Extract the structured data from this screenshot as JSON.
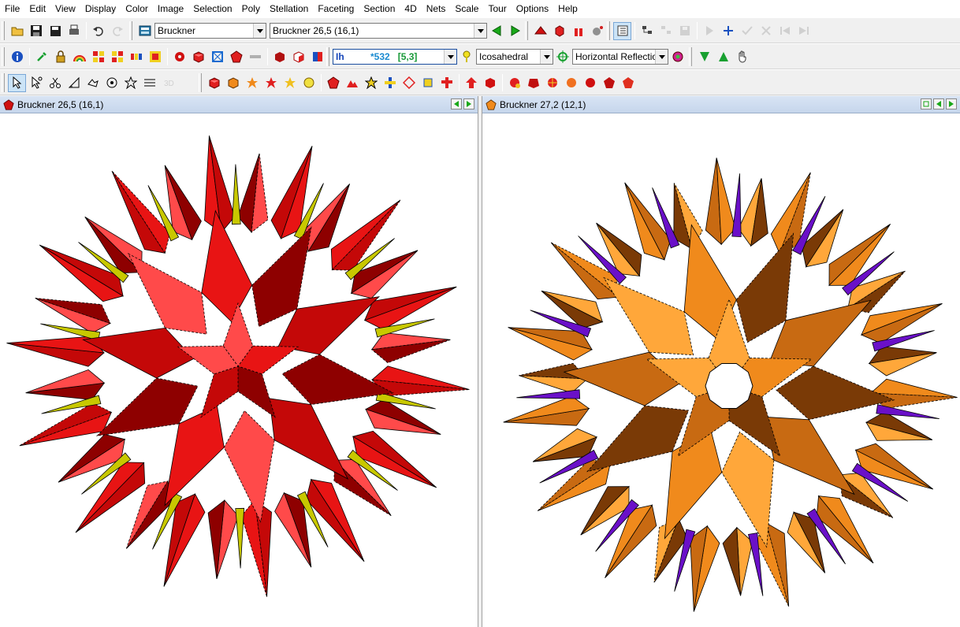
{
  "menu": [
    "File",
    "Edit",
    "View",
    "Display",
    "Color",
    "Image",
    "Selection",
    "Poly",
    "Stellation",
    "Faceting",
    "Section",
    "4D",
    "Nets",
    "Scale",
    "Tour",
    "Options",
    "Help"
  ],
  "toolbar1": {
    "category_value": "Bruckner",
    "model_value": "Bruckner 26,5 (16,1)"
  },
  "toolbar2": {
    "symmetry_label": "Ih",
    "symmetry_orbifold": "*532",
    "symmetry_coxeter": "[5,3]",
    "group_value": "Icosahedral",
    "reflection_value": "Horizontal Reflection"
  },
  "left_pane": {
    "title": "Bruckner 26,5 (16,1)",
    "colors": {
      "face": "#e81414",
      "dark": "#8e0000",
      "mid": "#c40808",
      "light": "#ff4a4a",
      "accent": "#c8c800"
    }
  },
  "right_pane": {
    "title": "Bruckner 27,2 (12,1)",
    "colors": {
      "face": "#f08a1c",
      "dark": "#7a3a06",
      "mid": "#c86a12",
      "light": "#ffa73a",
      "accent": "#6a10c8"
    }
  },
  "icons": {
    "toolbar1": [
      "open-icon",
      "save-icon",
      "save-all-icon",
      "print-icon",
      "undo-icon",
      "redo-icon",
      "model-category-icon",
      "prev-model-icon",
      "next-model-icon",
      "poly-red-icon",
      "poly-cube-icon",
      "poly-gift-icon",
      "poly-gray-icon",
      "list-view-icon",
      "tree-a-icon",
      "tree-b-icon",
      "save-gray-icon",
      "play-icon",
      "add-icon",
      "check-icon",
      "cross-icon",
      "first-icon",
      "last-icon"
    ],
    "toolbar2": [
      "info-icon",
      "wrench-icon",
      "lock-icon",
      "rainbow-icon",
      "grid-a-icon",
      "grid-b-icon",
      "grid-c-icon",
      "grid-d-icon",
      "gear-red-icon",
      "cube-red-icon",
      "frame-icon",
      "pentagon-red-icon",
      "bar-gray-icon",
      "box-icon",
      "box-white-icon",
      "book-icon",
      "key-icon",
      "target-icon",
      "pokeball-icon",
      "triangle-s-icon",
      "triangle-as-icon",
      "hand-icon"
    ],
    "toolbar3": [
      "select-arrow-icon",
      "select-move-icon",
      "scissors-icon",
      "triangle-ruler-icon",
      "shape-icon",
      "dots-circle-icon",
      "star-icon",
      "zigzag-icon",
      "3d-icon",
      "cube-red-icon",
      "cube-orange-icon",
      "star-orange-icon",
      "star-red-icon",
      "star-yellow-icon",
      "sphere-yellow-icon",
      "pentagon-red-icon",
      "mountain-icon",
      "star-outline-icon",
      "cross-blue-icon",
      "diamond-icon",
      "square-icon",
      "plus-red-icon",
      "arrow-red-icon",
      "cube-red-a-icon",
      "cube-red-b-icon",
      "cube-red-c-icon",
      "sphere-multi-icon",
      "sphere-orange-icon",
      "sphere-red-icon",
      "dodeca-red-icon",
      "dodeca-red-b-icon"
    ]
  }
}
